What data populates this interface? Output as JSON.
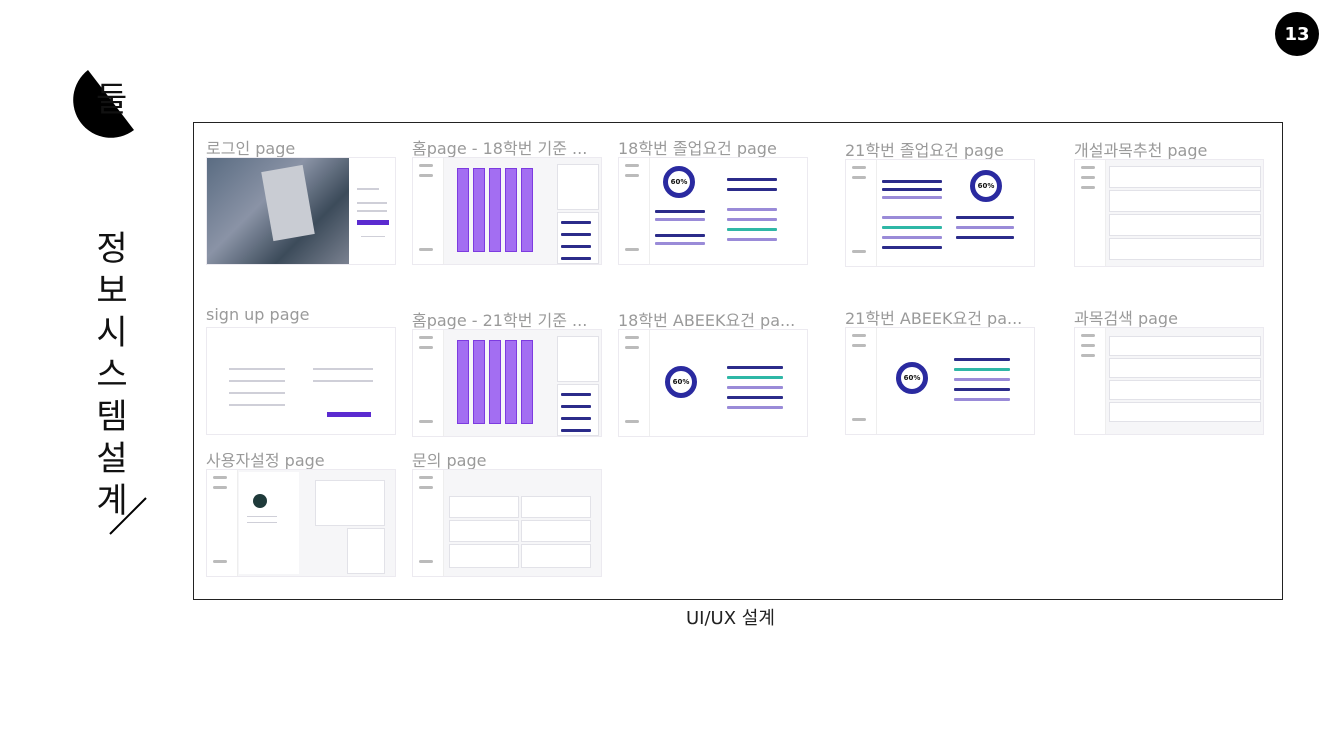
{
  "page_number": "13",
  "logo_text": "둘",
  "side_title_chars": [
    "정",
    "보",
    "시",
    "스",
    "템",
    "설",
    "계"
  ],
  "caption": "UI/UX 설계",
  "screens": [
    {
      "label": "로그인 page"
    },
    {
      "label": "홈page - 18학번 기준 ..."
    },
    {
      "label": "18학번 졸업요건 page"
    },
    {
      "label": "21학번 졸업요건 page"
    },
    {
      "label": "개설과목추천 page"
    },
    {
      "label": "sign up page"
    },
    {
      "label": "홈page - 21학번 기준 ..."
    },
    {
      "label": "18학번 ABEEK요건 pa..."
    },
    {
      "label": "21학번 ABEEK요건 pa..."
    },
    {
      "label": "과목검색 page"
    },
    {
      "label": "사용자설정 page"
    },
    {
      "label": "문의 page"
    }
  ],
  "donut_values": {
    "graduation_18": "60%",
    "graduation_21": "60%",
    "abeek_18": "60%",
    "abeek_21": "60%"
  },
  "colors": {
    "accent": "#5b2bd0",
    "bar": "#a36ef2",
    "dark_bar": "#2b2b8a"
  }
}
